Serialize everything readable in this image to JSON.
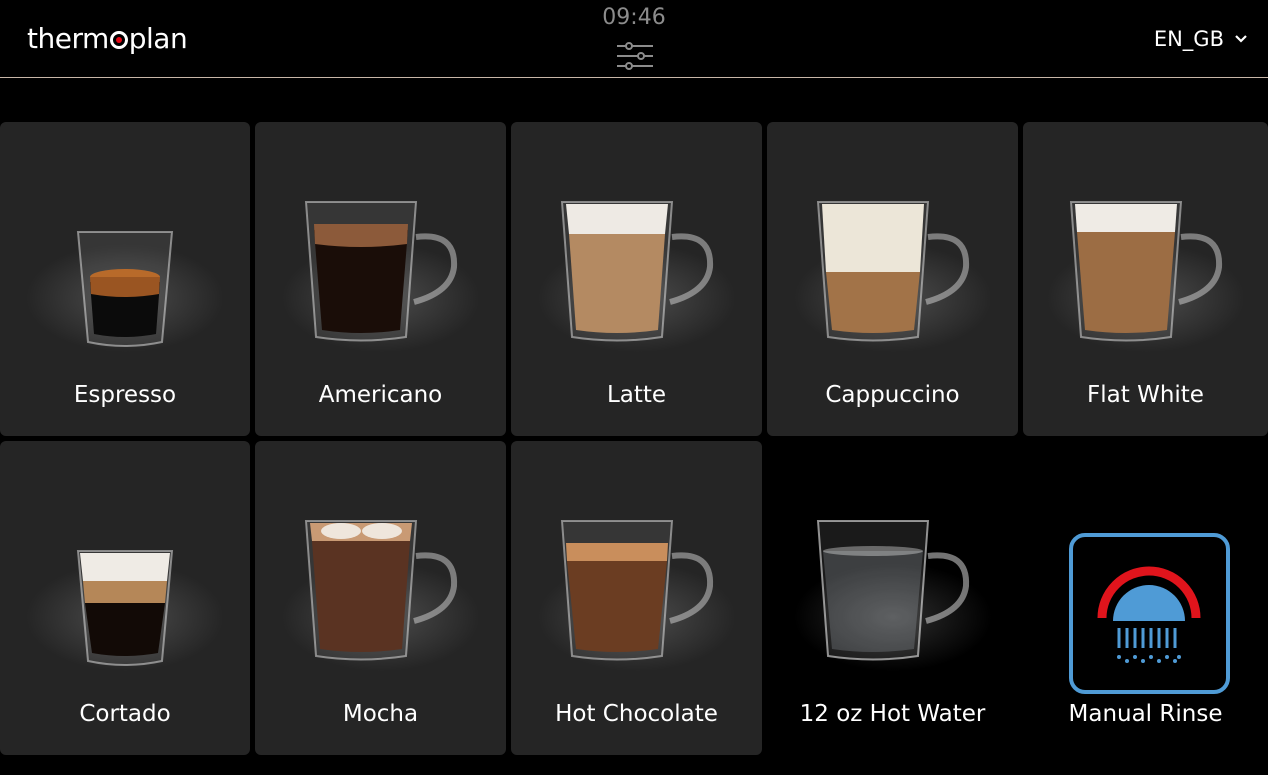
{
  "header": {
    "logo_text": "thermoplan",
    "time": "09:46",
    "language": "EN_GB",
    "settings_icon": "sliders-icon"
  },
  "colors": {
    "background": "#000000",
    "tile": "#252525",
    "accent_red": "#e30613",
    "rinse_blue": "#4f9bd6",
    "rinse_red": "#e0141c"
  },
  "products": [
    {
      "label": "Espresso",
      "icon": "espresso-cup"
    },
    {
      "label": "Americano",
      "icon": "americano-mug"
    },
    {
      "label": "Latte",
      "icon": "latte-mug"
    },
    {
      "label": "Cappuccino",
      "icon": "cappuccino-mug"
    },
    {
      "label": "Flat White",
      "icon": "flat-white-mug"
    },
    {
      "label": "Cortado",
      "icon": "cortado-cup"
    },
    {
      "label": "Mocha",
      "icon": "mocha-mug"
    },
    {
      "label": "Hot Chocolate",
      "icon": "hot-chocolate-mug"
    },
    {
      "label": "12 oz Hot Water",
      "icon": "hot-water-mug"
    },
    {
      "label": "Manual Rinse",
      "icon": "rinse-icon"
    }
  ]
}
